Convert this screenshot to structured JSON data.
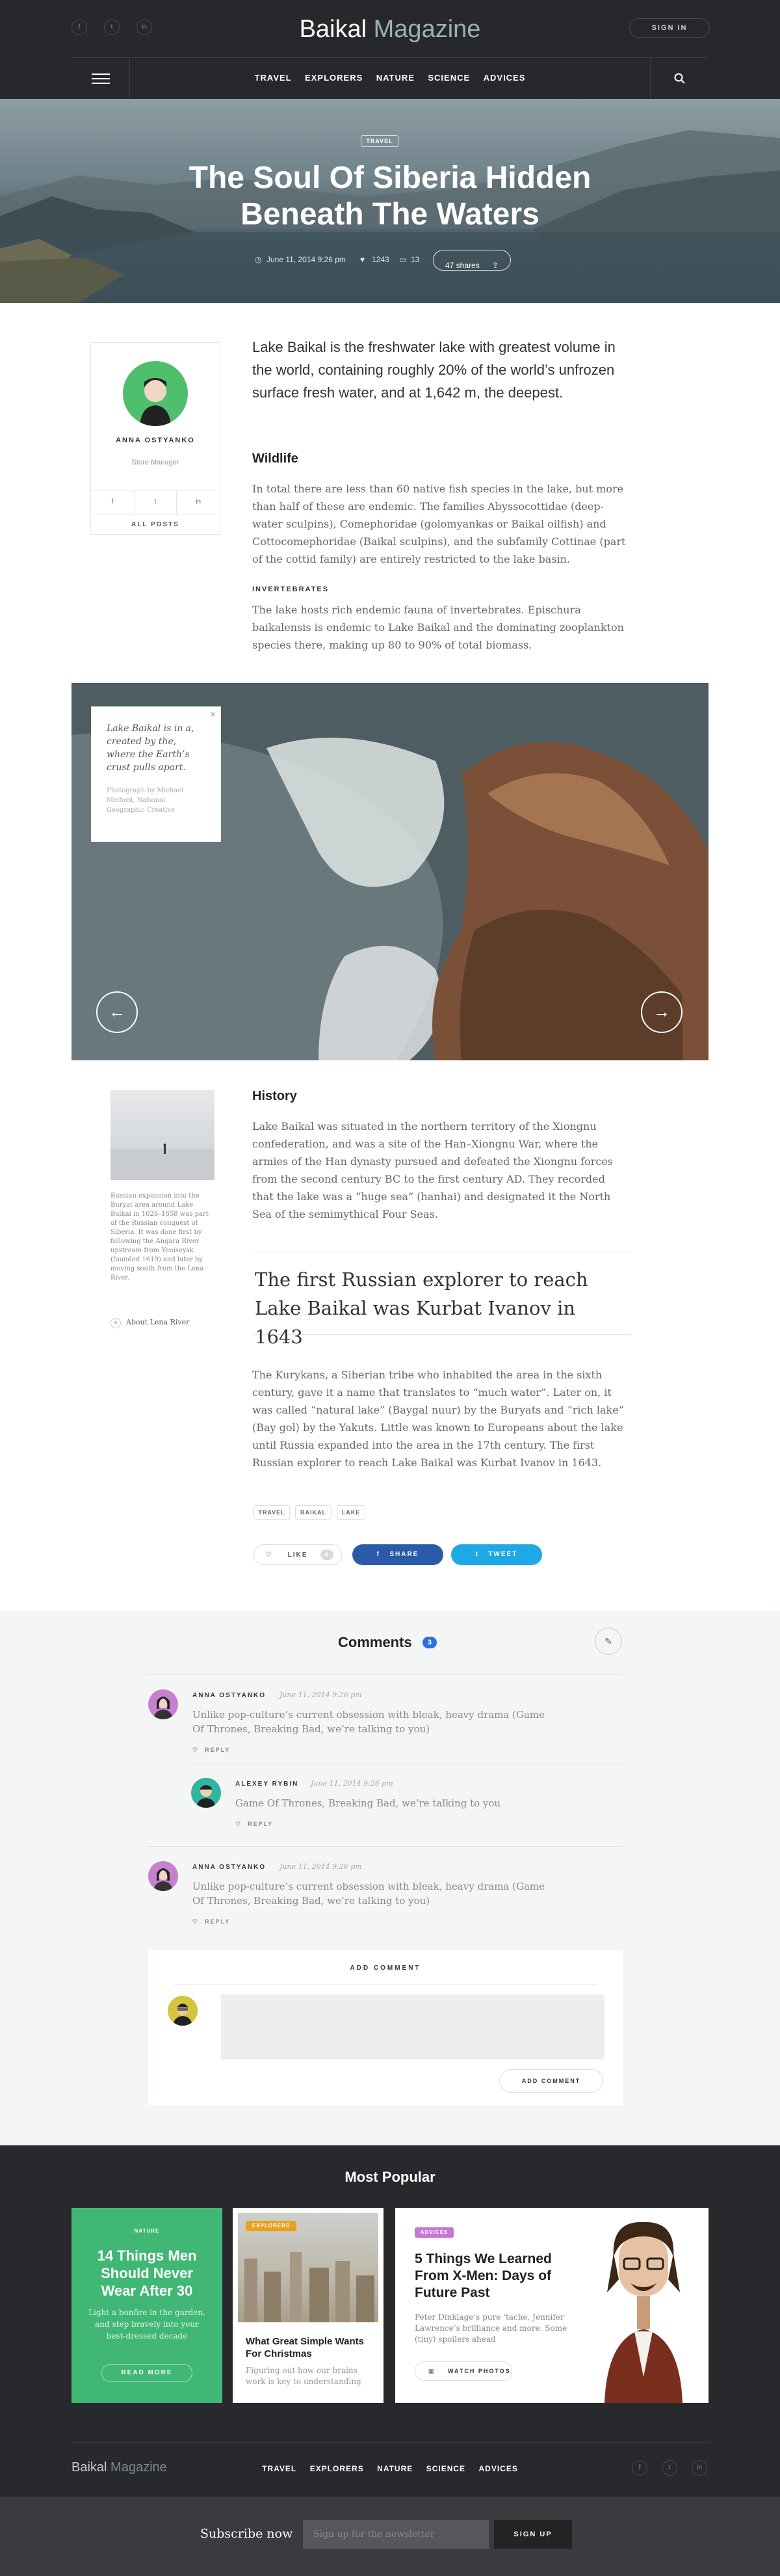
{
  "header": {
    "social": [
      "f",
      "t",
      "in"
    ],
    "brand_first": "Baikal",
    "brand_second": "Magazine",
    "sign_in": "SIGN IN",
    "nav": [
      "TRAVEL",
      "EXPLORERS",
      "NATURE",
      "SCIENCE",
      "ADVICES"
    ]
  },
  "hero": {
    "tag": "TRAVEL",
    "title": "The Soul Of Siberia Hidden Beneath The Waters",
    "date": "June 11, 2014 9:26 pm",
    "likes": "1243",
    "comments": "13",
    "shares": "47 shares"
  },
  "author": {
    "name": "ANNA OSTYANKO",
    "role": "Store Manager",
    "social": [
      "f",
      "t",
      "in"
    ],
    "all_posts": "ALL POSTS"
  },
  "article": {
    "lead": "Lake Baikal is the freshwater lake with greatest volume in the world, containing roughly 20% of the world’s unfrozen surface fresh water, and at 1,642 m, the deepest.",
    "wildlife_title": "Wildlife",
    "wildlife_text": "In total there are less than 60 native fish species in the lake, but more than half of these are endemic. The families Abyssocottidae (deep-water sculpins), Comephoridae (golomyankas or Baikal oilfish) and Cottocomephoridae (Baikal sculpins), and the subfamily Cottinae (part of the cottid family) are entirely restricted to the lake basin.",
    "invert_title": "INVERTEBRATES",
    "invert_text": "The lake hosts rich endemic fauna of invertebrates. Epischura baikalensis is endemic to Lake Baikal and the dominating zooplankton species there, making up 80 to 90% of total biomass.",
    "quote": "Lake Baikal is in a, created by the, where the Earth’s crust pulls apart.",
    "quote_credit": "Photograph by Michael Melford, National Geographic Creative",
    "thumb_caption": "Russian expansion into the Buryat area around Lake Baikal in 1628–1658 was part of the Russian conquest of Siberia. It was done first by following the Angara River upstream from Yeniseysk (founded 1619) and later by moving south from the Lena River.",
    "lena_link": "About Lena River",
    "history_title": "History",
    "history_text": "Lake Baikal was situated in the northern territory of the Xiongnu confederation, and was a site of the Han–Xiongnu War, where the armies of the Han dynasty pursued and defeated the Xiongnu forces from the second century BC to the first century AD. They recorded that the lake was a “huge sea” (hanhai) and designated it the North Sea of the semimythical Four Seas.",
    "pull_quote": "The first Russian explorer to reach Lake Baikal was Kurbat Ivanov in 1643",
    "history_text2": "The Kurykans, a Siberian tribe who inhabited the area in the sixth century, gave it a name that translates to “much water”. Later on, it was called “natural lake” (Baygal nuur) by the Buryats and “rich lake” (Bay gol) by the Yakuts. Little was known to Europeans about the lake until Russia expanded into the area in the 17th century. The first Russian explorer to reach Lake Baikal was Kurbat Ivanov in 1643.",
    "tags": [
      "TRAVEL",
      "BAIKAL",
      "LAKE"
    ],
    "like_label": "LIKE",
    "like_count": "4",
    "share_label": "SHARE",
    "tweet_label": "TWEET"
  },
  "comments": {
    "title": "Comments",
    "count": "3",
    "items": [
      {
        "name": "ANNA OSTYANKO",
        "date": "June 11, 2014 9:26 pm",
        "text": "Unlike pop-culture’s current obsession with bleak, heavy drama (Game Of Thrones, Breaking Bad, we’re talking to you)",
        "reply": "REPLY"
      },
      {
        "name": "ALEXEY RYBIN",
        "date": "June 11, 2014 9:26 pm",
        "text": "Game Of Thrones, Breaking Bad, we’re talking to you",
        "reply": "REPLY"
      },
      {
        "name": "ANNA OSTYANKO",
        "date": "June 11, 2014 9:26 pm",
        "text": "Unlike pop-culture’s current obsession with bleak, heavy drama (Game Of Thrones, Breaking Bad, we’re talking to you)",
        "reply": "REPLY"
      }
    ],
    "add_title": "ADD COMMENT",
    "add_button": "ADD COMMENT"
  },
  "popular": {
    "title": "Most Popular",
    "card1": {
      "badge": "NATURE",
      "title": "14 Things Men Should Never Wear After 30",
      "text": "Light a bonfire in the garden, and step bravely into your best-dressed decade",
      "button": "READ MORE"
    },
    "card2": {
      "badge": "EXPLORERS",
      "title": "What Great Simple Wants For Christmas",
      "text": "Figuring out how our brains work is key to understanding"
    },
    "card3": {
      "badge": "ADVICES",
      "title": "5 Things We Learned From X-Men: Days of Future Past",
      "text": "Peter Dinklage’s pure ‘tache, Jennifer Lawrence’s brilliance and more. Some (tiny) spoilers ahead",
      "button": "WATCH PHOTOS"
    }
  },
  "footer": {
    "brand_first": "Baikal",
    "brand_second": "Magazine",
    "nav": [
      "TRAVEL",
      "EXPLORERS",
      "NATURE",
      "SCIENCE",
      "ADVICES"
    ],
    "social": [
      "f",
      "t",
      "in"
    ]
  },
  "subscribe": {
    "title": "Subscribe now",
    "placeholder": "Sign up for the newsletter",
    "button": "SIGN UP"
  },
  "colors": {
    "dark": "#26282b",
    "accent": "#2f6fdb",
    "green": "#41b775",
    "facebook": "#2b5ba8",
    "twitter": "#1ea8e6"
  }
}
